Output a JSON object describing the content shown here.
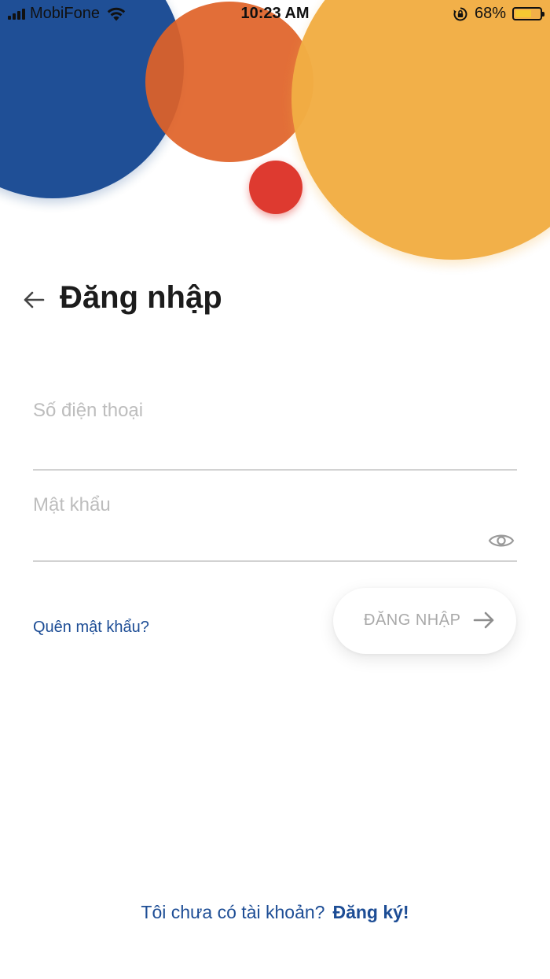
{
  "status_bar": {
    "carrier": "MobiFone",
    "time": "10:23 AM",
    "battery_percent": "68%",
    "battery_level": 0.68,
    "icons": [
      "signal-icon",
      "wifi-icon",
      "rotation-lock-icon",
      "battery-icon"
    ]
  },
  "header": {
    "back_icon": "arrow-left-icon",
    "title": "Đăng nhập"
  },
  "form": {
    "phone": {
      "value": "",
      "placeholder": "Số điện thoại"
    },
    "password": {
      "value": "",
      "placeholder": "Mật khẩu",
      "toggle_icon": "eye-icon"
    },
    "forgot_label": "Quên mật khẩu?",
    "submit_label": "ĐĂNG NHẬP",
    "submit_icon": "arrow-right-icon"
  },
  "footer": {
    "prompt": "Tôi chưa có tài khoản?",
    "register_label": "Đăng ký!"
  },
  "colors": {
    "brand_blue": "#1d4d95",
    "orange": "#e06227",
    "red": "#de3a30",
    "yellow": "#f2ae44"
  }
}
